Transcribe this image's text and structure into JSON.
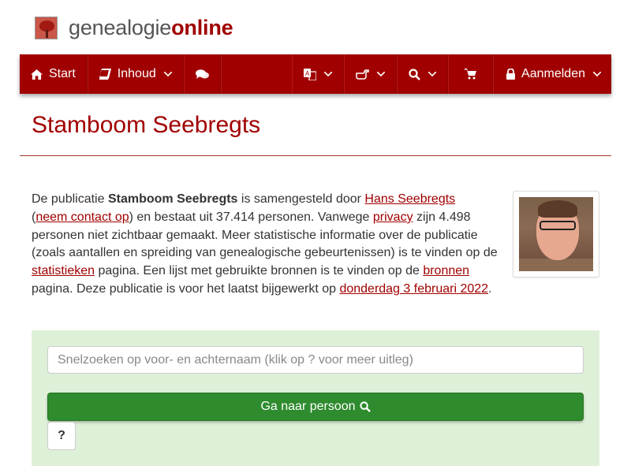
{
  "brand": {
    "part1": "genealogie",
    "part2": "online",
    "logo_icon": "tree-icon"
  },
  "nav": {
    "start_label": "Start",
    "content_label": "Inhoud",
    "login_label": "Aanmelden",
    "icons": [
      "home-icon",
      "book-icon",
      "comments-icon",
      "language-icon",
      "hand-pointer-icon",
      "search-icon",
      "cart-icon",
      "lock-icon"
    ]
  },
  "page": {
    "title": "Stamboom Seebregts"
  },
  "intro": {
    "t1": "De publicatie ",
    "publication": "Stamboom Seebregts",
    "t2": " is samengesteld door ",
    "author_link": "Hans Seebregts",
    "t3": "(",
    "contact_link": "neem contact op",
    "t4": ") en bestaat uit 37.414 personen. Vanwege ",
    "privacy_link": "privacy",
    "t5": " zijn 4.498 personen niet zichtbaar gemaakt. Meer statistische informatie over de publicatie (zoals aantallen en spreiding van genealogische gebeurtenissen) is te vinden op de ",
    "stats_link": "statistieken",
    "t6": " pagina. Een lijst met gebruikte bronnen is te vinden op de ",
    "sources_link": "bronnen",
    "t7": " pagina. Deze publicatie is voor het laatst bijgewerkt op ",
    "date_link": "donderdag 3 februari 2022",
    "t8": "."
  },
  "search": {
    "placeholder": "Snelzoeken op voor- en achternaam (klik op ? voor meer uitleg)",
    "go_label": "Ga naar persoon",
    "help_label": "?"
  },
  "colors": {
    "brand_red": "#a00000",
    "panel_green": "#dff0d8",
    "button_green": "#2e8b2e"
  }
}
